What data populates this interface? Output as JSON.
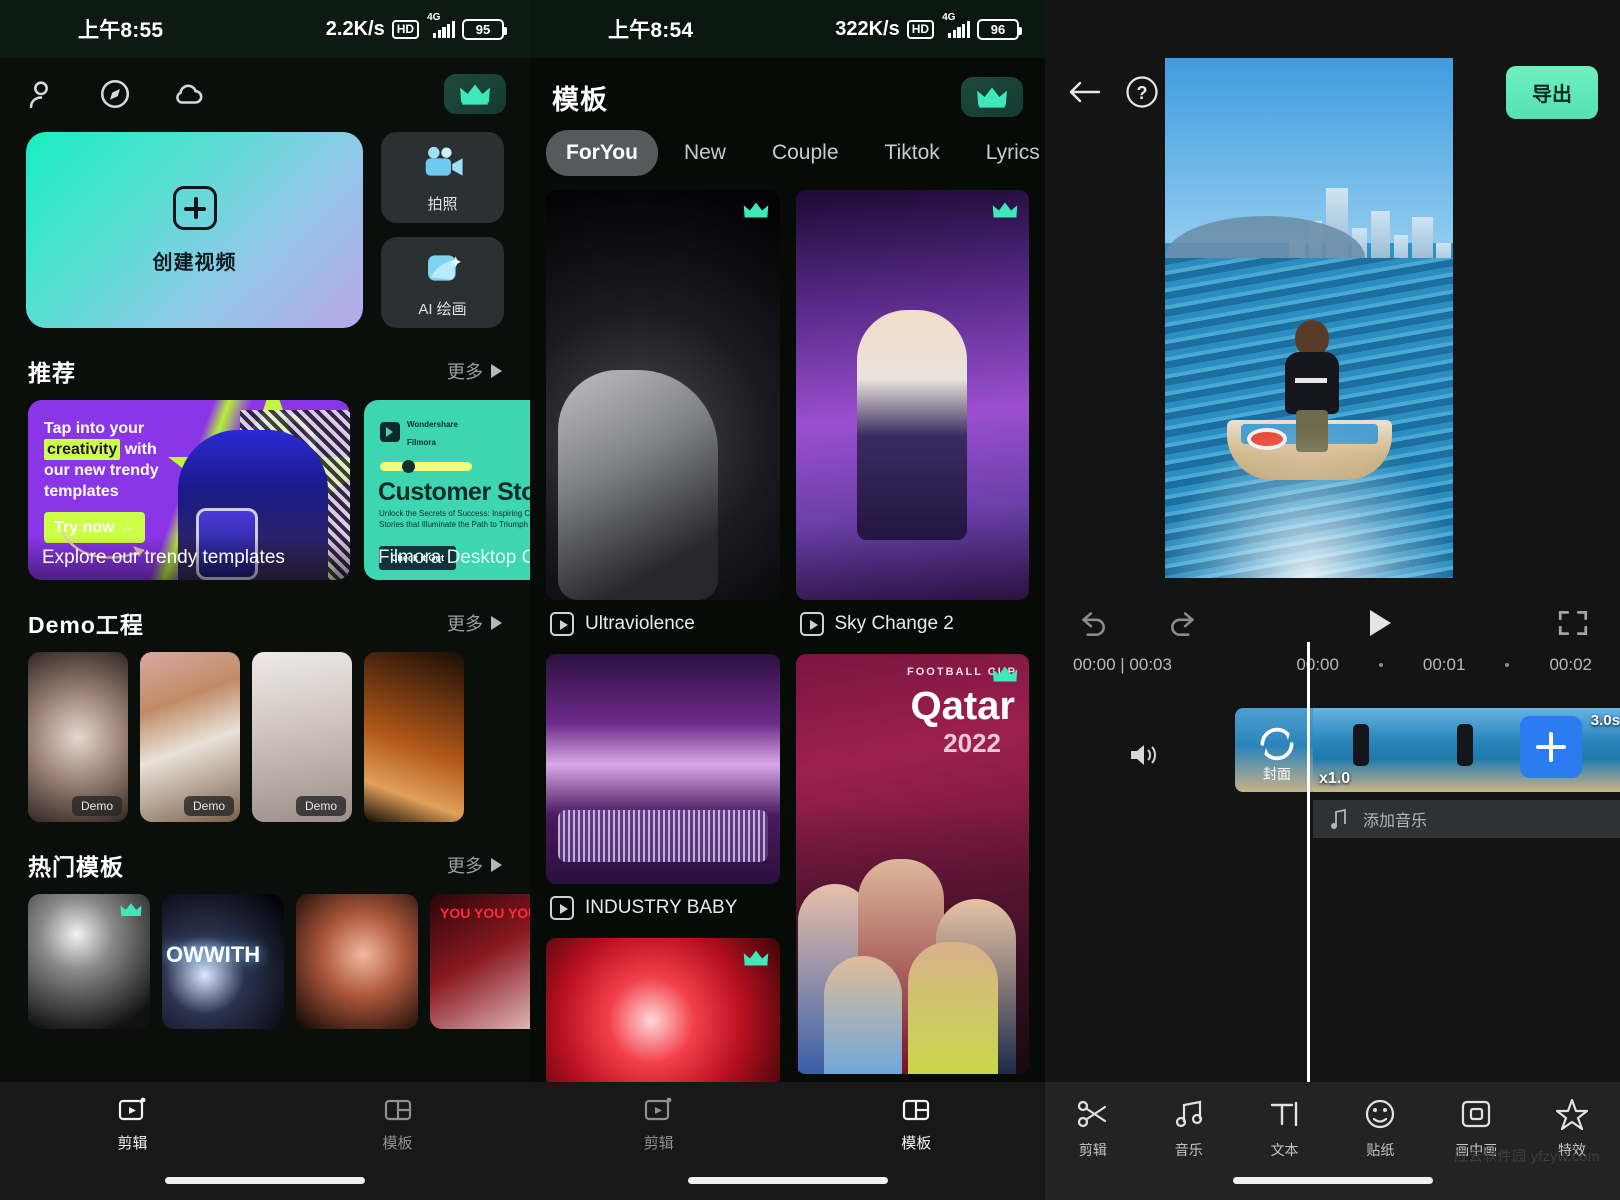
{
  "panels": {
    "home": {
      "status": {
        "time": "上午8:55",
        "speed": "2.2K/s",
        "hd": "HD",
        "net": "4G",
        "battery": "95"
      },
      "top_icons": [
        {
          "name": "account-icon",
          "label": "账户"
        },
        {
          "name": "compass-icon",
          "label": "发现"
        },
        {
          "name": "cloud-icon",
          "label": "云空间"
        }
      ],
      "pro_badge": "crown-icon",
      "create_card": {
        "label": "创建视频",
        "icon": "plus-icon"
      },
      "side_cards": [
        {
          "label": "拍照",
          "icon": "camcorder-icon"
        },
        {
          "label": "AI 绘画",
          "icon": "ai-paint-icon"
        }
      ],
      "sections": [
        {
          "title": "推荐",
          "more": "更多"
        },
        {
          "title": "Demo工程",
          "more": "更多"
        },
        {
          "title": "热门模板",
          "more": "更多"
        }
      ],
      "promos": [
        {
          "line1": "Tap into your",
          "highlight": "creativity",
          "line2_rest": "with",
          "line3": "our new trendy",
          "line4": "templates",
          "cta": "Try now →",
          "caption": "Explore our trendy templates"
        },
        {
          "brand_line1": "Wondershare",
          "brand_line2": "Filmora",
          "title": "Customer Story",
          "sub": "Unlock the Secrets of Success: Inspiring Customer Stories that Illuminate the Path to Triumph",
          "cta": "Check it Out",
          "caption": "Filmora Desktop Cus"
        }
      ],
      "demo_tag": "Demo",
      "hot_overlay_text": "OWWITH",
      "hot_you_text": "YOU YOU YOU",
      "nav": [
        {
          "label": "剪辑",
          "icon": "clip-icon",
          "active": true
        },
        {
          "label": "模板",
          "icon": "template-icon",
          "active": false
        }
      ]
    },
    "templates": {
      "status": {
        "time": "上午8:54",
        "speed": "322K/s",
        "hd": "HD",
        "net": "4G",
        "battery": "96"
      },
      "title": "模板",
      "pro_badge": "crown-icon",
      "tabs": [
        {
          "label": "ForYou",
          "active": true
        },
        {
          "label": "New",
          "active": false
        },
        {
          "label": "Couple",
          "active": false
        },
        {
          "label": "Tiktok",
          "active": false
        },
        {
          "label": "Lyrics",
          "active": false
        }
      ],
      "cards": [
        {
          "title": "Ultraviolence",
          "pro": true
        },
        {
          "title": "Sky Change 2",
          "pro": true
        },
        {
          "title": "INDUSTRY BABY",
          "pro": false
        },
        {
          "title": "",
          "pro": true,
          "overlay_top": "FOOTBALL CUP",
          "overlay_main": "Qatar",
          "overlay_year": "2022"
        },
        {
          "title": "",
          "pro": true
        }
      ],
      "nav": [
        {
          "label": "剪辑",
          "icon": "clip-icon",
          "active": false
        },
        {
          "label": "模板",
          "icon": "template-icon",
          "active": true
        }
      ]
    },
    "editor": {
      "back": "back-arrow-icon",
      "help": "help-icon",
      "export_label": "导出",
      "controls": {
        "undo": "undo-icon",
        "redo": "redo-icon",
        "play": "play-icon",
        "fullscreen": "fullscreen-icon"
      },
      "timecode": "00:00 | 00:03",
      "ruler": [
        "00:00",
        "00:01",
        "00:02"
      ],
      "timeline": {
        "volume_icon": "speaker-icon",
        "cover_label": "封面",
        "speed_label": "x1.0",
        "duration_label": "3.0s",
        "add_clip": "plus-icon",
        "music_label": "添加音乐",
        "music_icon": "note-icon"
      },
      "toolbar": [
        {
          "label": "剪辑",
          "icon": "scissors-icon"
        },
        {
          "label": "音乐",
          "icon": "music-note-icon"
        },
        {
          "label": "文本",
          "icon": "text-icon"
        },
        {
          "label": "贴纸",
          "icon": "sticker-icon"
        },
        {
          "label": "画中画",
          "icon": "pip-icon"
        },
        {
          "label": "特效",
          "icon": "effects-icon"
        }
      ],
      "watermark": "应云软件园 yfzyw.com"
    }
  },
  "colors": {
    "accent_green": "#55e0b4",
    "dark_bg": "#000000",
    "panel_bg": "#141414",
    "blue_add": "#2b7cf0"
  }
}
